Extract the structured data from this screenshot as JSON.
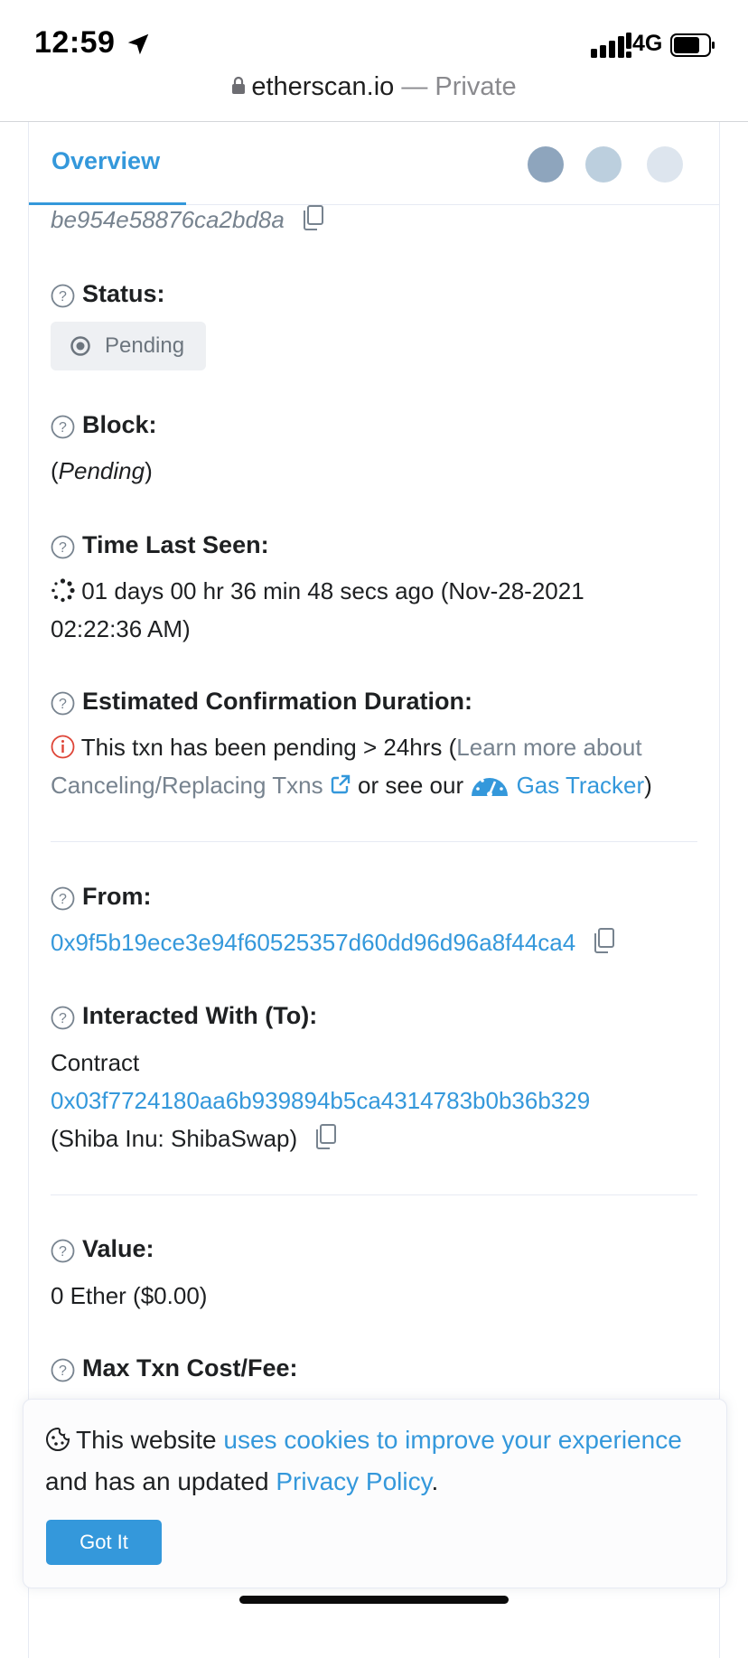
{
  "status_bar": {
    "time": "12:59",
    "network": "4G"
  },
  "url_bar": {
    "host": "etherscan.io",
    "private_label": " — Private"
  },
  "tabs": {
    "overview_label": "Overview"
  },
  "tx": {
    "hash_tail": "be954e58876ca2bd8a",
    "status": {
      "label": "Status:",
      "badge": "Pending"
    },
    "block": {
      "label": "Block:",
      "open": "(",
      "value": "Pending",
      "close": ")"
    },
    "time_last_seen": {
      "label": "Time Last Seen:",
      "line1": " 01 days 00 hr 36 min 48 secs ago (Nov-28-2021",
      "line2": "02:22:36 AM)"
    },
    "est_confirmation": {
      "label": "Estimated Confirmation Duration:",
      "text1": " This txn has been pending > 24hrs (",
      "learn_more_1": "Learn more about",
      "learn_more_2": "Canceling/Replacing Txns",
      "or_see": " or see our ",
      "gas_tracker": "Gas Tracker",
      "close": ")"
    },
    "from": {
      "label": "From:",
      "address": "0x9f5b19ece3e94f60525357d60dd96d96a8f44ca4"
    },
    "to": {
      "label": "Interacted With (To):",
      "prefix": "Contract",
      "address": "0x03f7724180aa6b939894b5ca4314783b0b36b329",
      "name": "(Shiba Inu: ShibaSwap)"
    },
    "value": {
      "label": "Value:",
      "amount": "0 Ether ($0.00)"
    },
    "max_fee": {
      "label": "Max Txn Cost/Fee:"
    }
  },
  "cookie_banner": {
    "text1": "This website ",
    "link1": "uses cookies to improve your experience",
    "text2": " and has an updated ",
    "link2": "Privacy Policy",
    "text3": ".",
    "button": "Got It"
  },
  "colors": {
    "accent": "#3498db",
    "muted": "#77838f",
    "error": "#de4437"
  }
}
